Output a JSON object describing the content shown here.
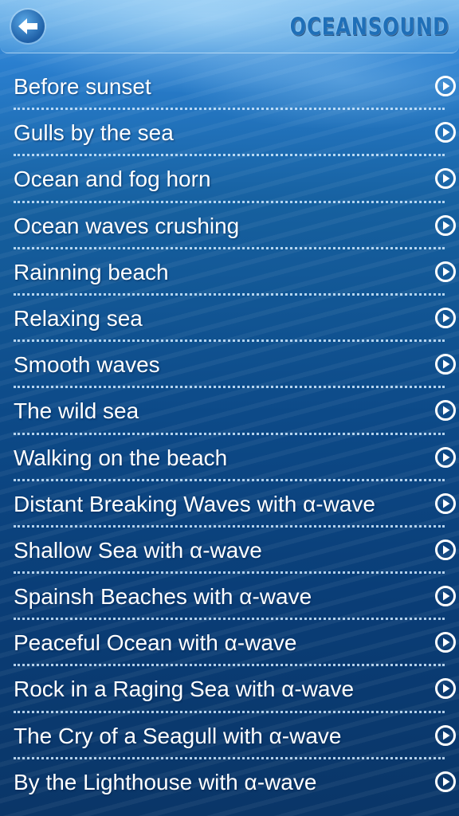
{
  "header": {
    "logo_text": "OCEANSOUND"
  },
  "list": {
    "items": [
      {
        "label": "Before sunset"
      },
      {
        "label": "Gulls by the sea"
      },
      {
        "label": "Ocean and fog horn"
      },
      {
        "label": "Ocean waves crushing"
      },
      {
        "label": "Rainning beach"
      },
      {
        "label": "Relaxing sea"
      },
      {
        "label": "Smooth waves"
      },
      {
        "label": "The wild sea"
      },
      {
        "label": "Walking on the beach"
      },
      {
        "label": "Distant Breaking Waves with α-wave"
      },
      {
        "label": "Shallow Sea with α-wave"
      },
      {
        "label": "Spainsh Beaches with α-wave"
      },
      {
        "label": "Peaceful Ocean with α-wave"
      },
      {
        "label": "Rock in a Raging Sea with α-wave"
      },
      {
        "label": "The Cry of a Seagull with α-wave"
      },
      {
        "label": "By the Lighthouse with α-wave"
      }
    ]
  },
  "icons": {
    "back": "back-arrow-icon",
    "play": "play-icon"
  },
  "colors": {
    "text": "#ffffff",
    "accent": "#1f6fb8",
    "background": "#0d4a88"
  }
}
